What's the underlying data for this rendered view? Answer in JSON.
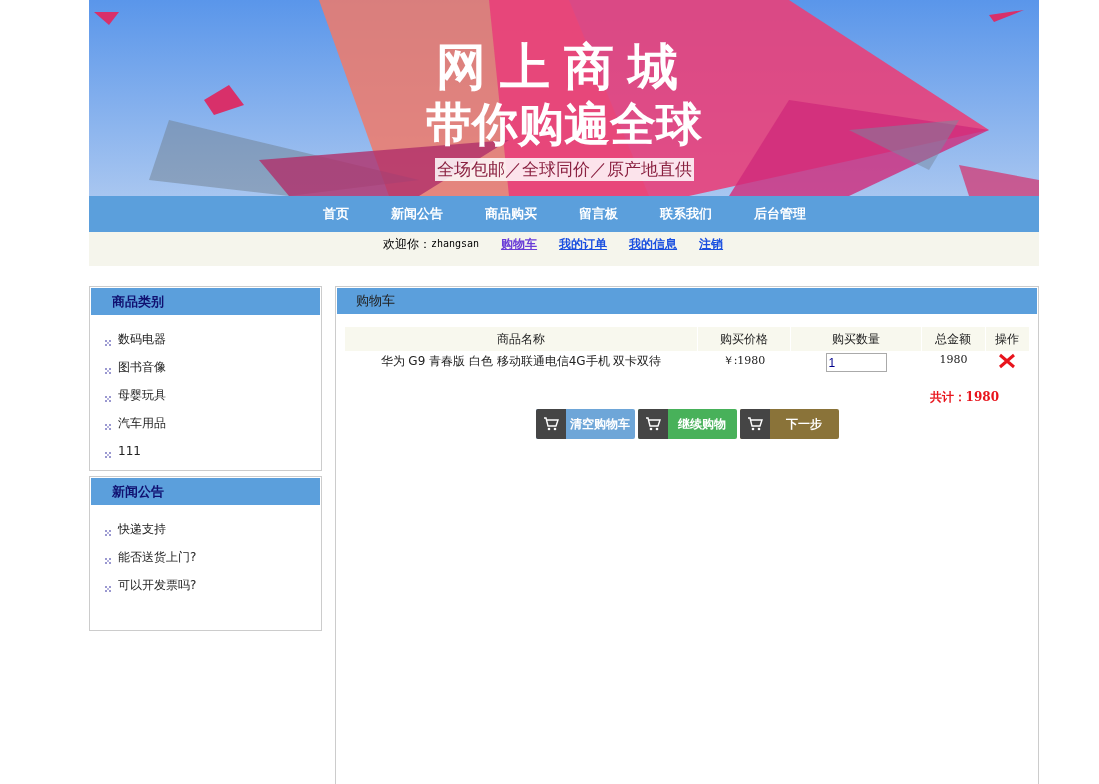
{
  "banner": {
    "title": "网上商城",
    "headline": "带你购遍全球",
    "tagline": "全场包邮／全球同价／原产地直供"
  },
  "nav": [
    "首页",
    "新闻公告",
    "商品购买",
    "留言板",
    "联系我们",
    "后台管理"
  ],
  "user_bar": {
    "greeting": "欢迎你：",
    "username": "zhangsan",
    "links": [
      {
        "label": "购物车",
        "selected": true
      },
      {
        "label": "我的订单",
        "selected": false
      },
      {
        "label": "我的信息",
        "selected": false
      },
      {
        "label": "注销",
        "selected": false
      }
    ]
  },
  "sidebar": [
    {
      "title": "商品类别",
      "items": [
        "数码电器",
        "图书音像",
        "母婴玩具",
        "汽车用品",
        "111"
      ]
    },
    {
      "title": "新闻公告",
      "items": [
        "快递支持",
        "能否送货上门?",
        "可以开发票吗?"
      ]
    }
  ],
  "cart": {
    "title": "购物车",
    "columns": [
      "商品名称",
      "购买价格",
      "购买数量",
      "总金额",
      "操作"
    ],
    "rows": [
      {
        "name": "华为 G9 青春版 白色 移动联通电信4G手机 双卡双待",
        "price": "￥:1980",
        "quantity": "1",
        "total": "1980"
      }
    ],
    "total": "共计：1980",
    "buttons": [
      {
        "label": "清空购物车",
        "kind": "clear"
      },
      {
        "label": "继续购物",
        "kind": "continue"
      },
      {
        "label": "下一步",
        "kind": "next"
      }
    ]
  }
}
